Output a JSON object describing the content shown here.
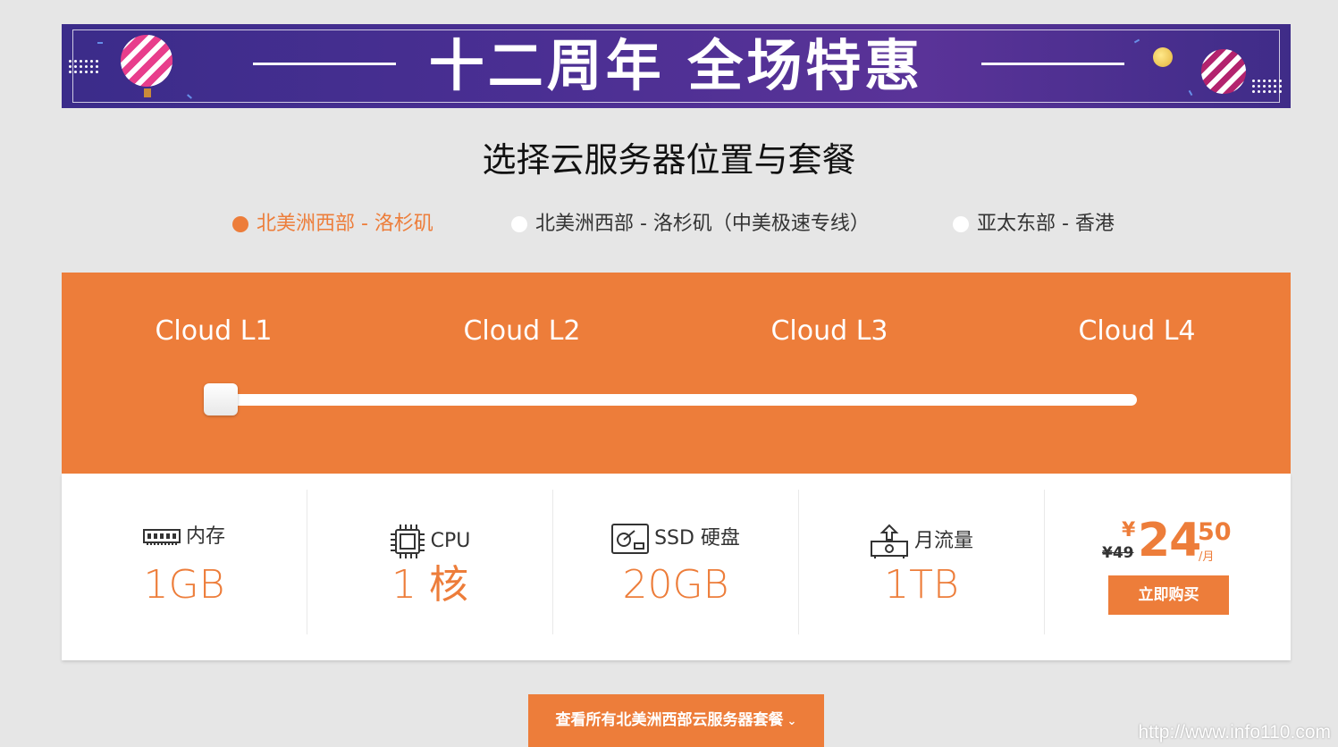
{
  "banner": {
    "title": "十二周年 全场特惠"
  },
  "heading": "选择云服务器位置与套餐",
  "locations": [
    {
      "label": "北美洲西部 - 洛杉矶",
      "selected": true
    },
    {
      "label": "北美洲西部 - 洛杉矶（中美极速专线）",
      "selected": false
    },
    {
      "label": "亚太东部 - 香港",
      "selected": false
    }
  ],
  "plans": {
    "labels": [
      "Cloud L1",
      "Cloud L2",
      "Cloud L3",
      "Cloud L4"
    ],
    "selected_index": 0
  },
  "specs": {
    "memory": {
      "label": "内存",
      "value": "1GB",
      "icon": "memory-icon"
    },
    "cpu": {
      "label": "CPU",
      "value": "1 核",
      "icon": "cpu-icon"
    },
    "disk": {
      "label": "SSD 硬盘",
      "value": "20GB",
      "icon": "ssd-icon"
    },
    "traffic": {
      "label": "月流量",
      "value": "1TB",
      "icon": "traffic-icon"
    }
  },
  "price": {
    "old": "¥49",
    "currency": "¥",
    "integer": "24",
    "decimal": "50",
    "per": "/月",
    "buy_label": "立即购买"
  },
  "view_all_label": "查看所有北美洲西部云服务器套餐",
  "watermark": "http://www.info110.com",
  "colors": {
    "accent": "#ed7d3a",
    "banner": "#4b2f93",
    "background": "#e6e6e6"
  }
}
